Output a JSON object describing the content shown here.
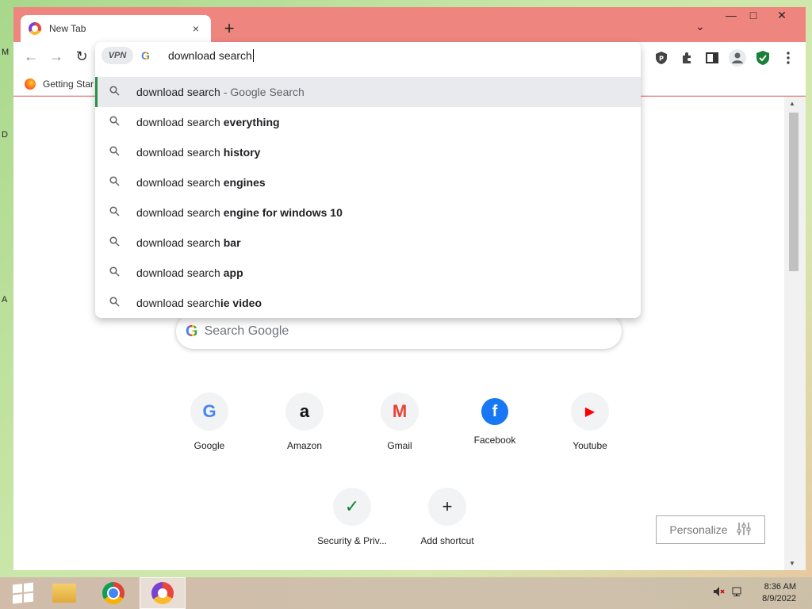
{
  "desktop": {
    "edge_letters": [
      "M",
      "D",
      "A"
    ]
  },
  "tab": {
    "title": "New Tab",
    "close": "×",
    "new_tab": "+"
  },
  "window_controls": {
    "dropdown": "⌄",
    "minimize": "—",
    "maximize": "□",
    "close": "✕"
  },
  "nav": {
    "back": "←",
    "forward": "→",
    "reload": "↻"
  },
  "omnibox": {
    "vpn_label": "VPN",
    "engine": "G",
    "typed_text": "download search",
    "suggestions": [
      {
        "prefix": "download search",
        "bold": "",
        "hint": "- Google Search",
        "selected": true
      },
      {
        "prefix": "download search ",
        "bold": "everything"
      },
      {
        "prefix": "download search ",
        "bold": "history"
      },
      {
        "prefix": "download search ",
        "bold": "engines"
      },
      {
        "prefix": "download search ",
        "bold": "engine for windows 10"
      },
      {
        "prefix": "download search ",
        "bold": "bar"
      },
      {
        "prefix": "download search ",
        "bold": "app"
      },
      {
        "prefix": "download search",
        "bold": "ie video"
      }
    ]
  },
  "toolbar_icons": [
    "shield-p-icon",
    "puzzle-icon",
    "sidepanel-icon",
    "profile-icon",
    "green-shield-icon",
    "menu-icon"
  ],
  "bookmarks": [
    {
      "label": "Getting Star"
    }
  ],
  "page": {
    "search_placeholder": "Search Google",
    "shortcuts": [
      {
        "label": "Google",
        "glyph": "G",
        "color": "#4285f4"
      },
      {
        "label": "Amazon",
        "glyph": "a",
        "color": "#111111"
      },
      {
        "label": "Gmail",
        "glyph": "M",
        "color": "#ea4335"
      },
      {
        "label": "Facebook",
        "glyph": "f",
        "color": "#1877f2"
      },
      {
        "label": "Youtube",
        "glyph": "▶",
        "color": "#ff0000"
      },
      {
        "label": "Security & Priv...",
        "glyph": "✓",
        "color": "#188038"
      },
      {
        "label": "Add shortcut",
        "glyph": "+",
        "color": "#202124"
      }
    ],
    "personalize_label": "Personalize"
  },
  "taskbar": {
    "clock_time": "8:36 AM",
    "clock_date": "8/9/2022"
  }
}
